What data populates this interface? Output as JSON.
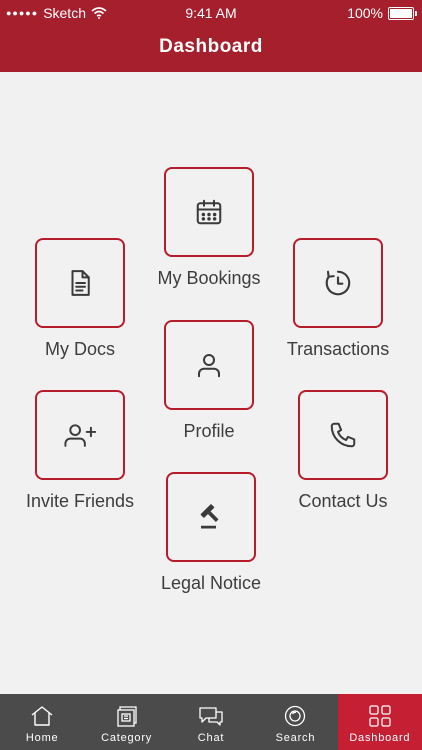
{
  "status_bar": {
    "carrier": "Sketch",
    "time": "9:41 AM",
    "battery": "100%"
  },
  "header": {
    "title": "Dashboard"
  },
  "tiles": {
    "bookings": {
      "label": "My Bookings",
      "icon": "calendar-icon"
    },
    "docs": {
      "label": "My Docs",
      "icon": "document-icon"
    },
    "transactions": {
      "label": "Transactions",
      "icon": "history-clock-icon"
    },
    "profile": {
      "label": "Profile",
      "icon": "user-icon"
    },
    "invite": {
      "label": "Invite Friends",
      "icon": "add-user-icon"
    },
    "contact": {
      "label": "Contact Us",
      "icon": "phone-icon"
    },
    "legal": {
      "label": "Legal Notice",
      "icon": "gavel-icon"
    }
  },
  "tab_bar": {
    "items": [
      {
        "label": "Home",
        "icon": "home-icon"
      },
      {
        "label": "Category",
        "icon": "category-icon"
      },
      {
        "label": "Chat",
        "icon": "chat-icon"
      },
      {
        "label": "Search",
        "icon": "search-icon"
      },
      {
        "label": "Dashboard",
        "icon": "grid-icon",
        "active": true
      }
    ]
  },
  "colors": {
    "brand": "#a51f2d",
    "tile_border": "#b71c2b",
    "active_tab": "#c51f33",
    "tab_bar": "#4b4b4b"
  }
}
